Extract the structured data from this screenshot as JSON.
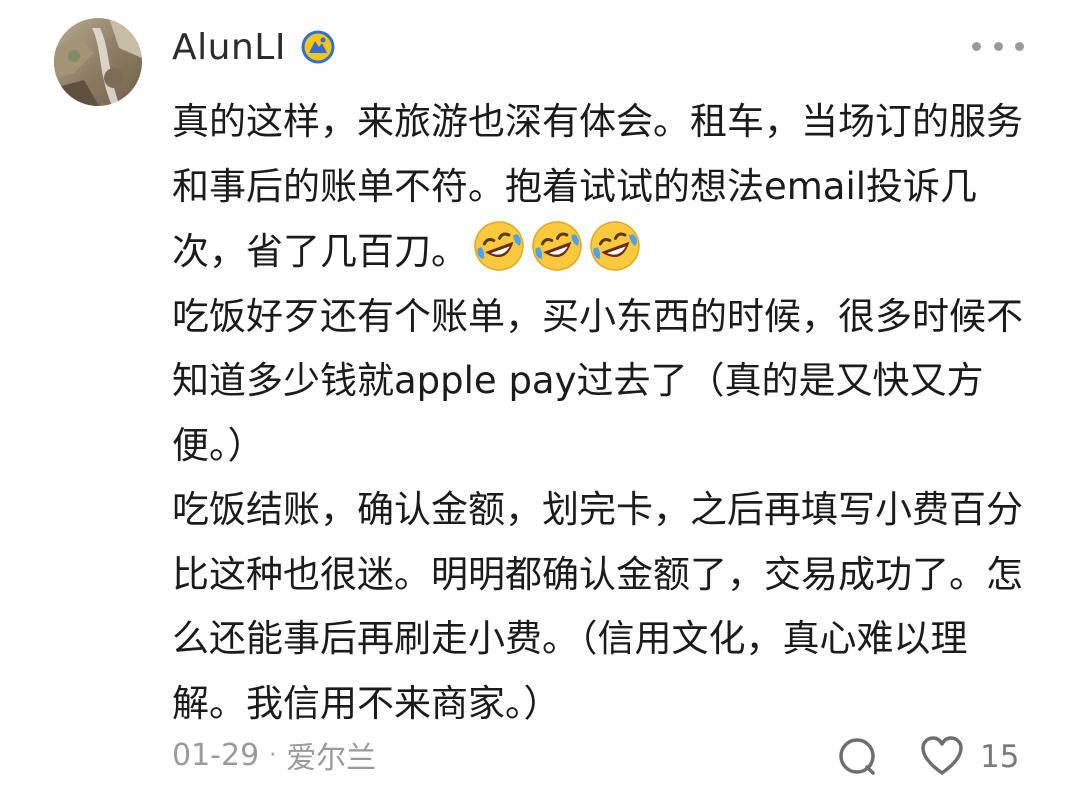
{
  "comment": {
    "author": "AlunLI",
    "badge_icon": "verified-badge-icon",
    "more_icon": "more-options-icon",
    "paragraphs": [
      {
        "text": "真的这样，来旅游也深有体会。租车，当场订的服务和事后的账单不符。抱着试试的想法email投诉几次，省了几百刀。",
        "emoji": [
          "rofl-emoji",
          "rofl-emoji",
          "rofl-emoji"
        ]
      },
      {
        "text": "吃饭好歹还有个账单，买小东西的时候，很多时候不知道多少钱就apple pay过去了（真的是又快又方便。）"
      },
      {
        "text": "吃饭结账，确认金额，划完卡，之后再填写小费百分比这种也很迷。明明都确认金额了，交易成功了。怎么还能事后再刷走小费。（信用文化，真心难以理解。我信用不来商家。）"
      }
    ],
    "date": "01-29",
    "separator": "·",
    "location": "爱尔兰",
    "like_count": "15",
    "reply_icon": "comment-icon",
    "like_icon": "heart-icon"
  },
  "colors": {
    "text": "#1b1b1b",
    "meta": "#9a9a9a",
    "badge_blue": "#2f6fd6",
    "badge_yellow": "#f5c518",
    "emoji_yellow": "#fbc93d"
  }
}
